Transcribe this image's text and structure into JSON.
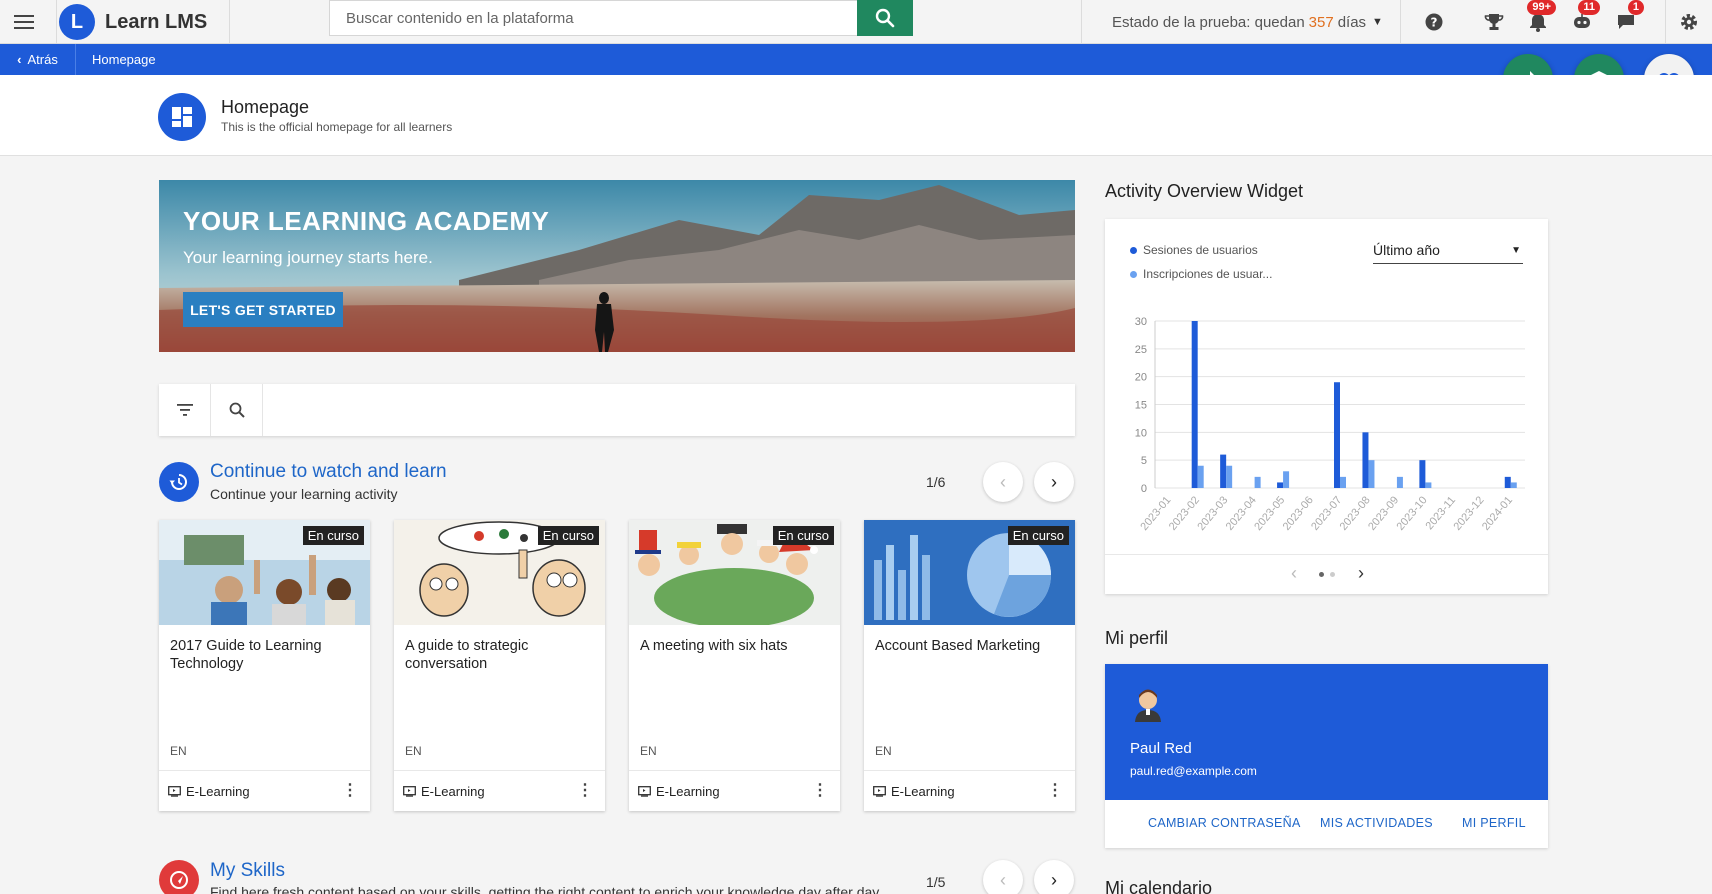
{
  "brand": {
    "logo_letter": "L",
    "name": "Learn LMS"
  },
  "search": {
    "placeholder": "Buscar contenido en la plataforma"
  },
  "trial": {
    "prefix": "Estado de la prueba: quedan",
    "days": "357",
    "suffix": "días"
  },
  "notifications": {
    "alerts_badge": "99+",
    "messages_badge": "11",
    "chat_badge": "1"
  },
  "breadcrumb": {
    "back_label": "Atrás",
    "current": "Homepage"
  },
  "page": {
    "title": "Homepage",
    "subtitle": "This is the official homepage for all learners"
  },
  "hero": {
    "title": "YOUR LEARNING ACADEMY",
    "subtitle": "Your learning journey starts here.",
    "button_label": "LET'S GET STARTED"
  },
  "continue_section": {
    "title": "Continue to watch and learn",
    "subtitle": "Continue your learning activity",
    "pager": "1/6",
    "cards": [
      {
        "title": "2017 Guide to Learning Technology",
        "status": "En curso",
        "language": "EN",
        "type": "E-Learning"
      },
      {
        "title": "A guide to strategic conversation",
        "status": "En curso",
        "language": "EN",
        "type": "E-Learning"
      },
      {
        "title": "A meeting with six hats",
        "status": "En curso",
        "language": "EN",
        "type": "E-Learning"
      },
      {
        "title": "Account Based Marketing",
        "status": "En curso",
        "language": "EN",
        "type": "E-Learning"
      }
    ]
  },
  "skills_section": {
    "title": "My Skills",
    "subtitle": "Find here fresh content based on your skills, getting the right content to enrich your knowledge day after day",
    "pager": "1/5"
  },
  "activity_widget": {
    "title": "Activity Overview Widget",
    "period": "Último año",
    "colors": {
      "sessions": "#1e5bd8",
      "enrollments": "#6aa1f0"
    }
  },
  "chart_data": {
    "type": "bar",
    "categories": [
      "2023-01",
      "2023-02",
      "2023-03",
      "2023-04",
      "2023-05",
      "2023-06",
      "2023-07",
      "2023-08",
      "2023-09",
      "2023-10",
      "2023-11",
      "2023-12",
      "2024-01"
    ],
    "series": [
      {
        "name": "Sesiones de usuarios",
        "values": [
          0,
          30,
          6,
          0,
          1,
          0,
          19,
          10,
          0,
          5,
          0,
          0,
          2
        ]
      },
      {
        "name": "Inscripciones de usuar...",
        "values": [
          0,
          4,
          4,
          2,
          3,
          0,
          2,
          5,
          2,
          1,
          0,
          0,
          1
        ]
      }
    ],
    "yticks": [
      0,
      5,
      10,
      15,
      20,
      25,
      30
    ],
    "ylim": [
      0,
      30
    ],
    "grid": true,
    "legend": "top-left"
  },
  "profile": {
    "section_title": "Mi perfil",
    "name": "Paul Red",
    "email": "paul.red@example.com",
    "links": {
      "change_password": "CAMBIAR CONTRASEÑA",
      "my_activities": "MIS ACTIVIDADES",
      "my_profile": "MI PERFIL"
    }
  },
  "calendar": {
    "title": "Mi calendario"
  }
}
